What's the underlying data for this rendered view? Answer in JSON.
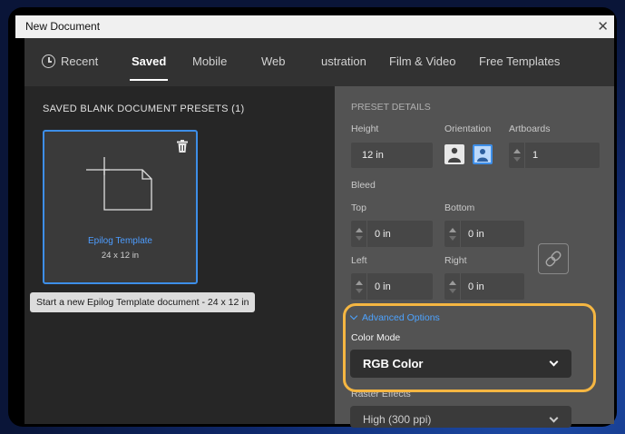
{
  "window": {
    "title": "New Document",
    "close_glyph": "✕"
  },
  "tabs": [
    {
      "label": "Recent",
      "icon": "clock-icon"
    },
    {
      "label": "Saved",
      "active": true
    },
    {
      "label": "Mobile"
    },
    {
      "label": "Web"
    },
    {
      "label": "ustration"
    },
    {
      "label": "Film & Video"
    },
    {
      "label": "Free Templates"
    }
  ],
  "presets": {
    "heading": "SAVED BLANK DOCUMENT PRESETS  (1)",
    "card": {
      "name": "Epilog Template",
      "size": "24 x 12 in"
    },
    "tooltip": "Start a new Epilog Template document - 24 x 12 in"
  },
  "details": {
    "heading": "PRESET DETAILS",
    "height_label": "Height",
    "height_value": "12 in",
    "orientation_label": "Orientation",
    "artboards_label": "Artboards",
    "artboards_value": "1",
    "bleed_label": "Bleed",
    "top_label": "Top",
    "top_value": "0 in",
    "bottom_label": "Bottom",
    "bottom_value": "0 in",
    "left_label": "Left",
    "left_value": "0 in",
    "right_label": "Right",
    "right_value": "0 in",
    "advanced_label": "Advanced Options",
    "color_mode_label": "Color Mode",
    "color_mode_value": "RGB Color",
    "raster_label": "Raster Effects",
    "raster_value": "High (300 ppi)"
  },
  "colors": {
    "accent": "#3d8ee8",
    "highlight": "#f5b642",
    "link_blue": "#4da3ff"
  }
}
